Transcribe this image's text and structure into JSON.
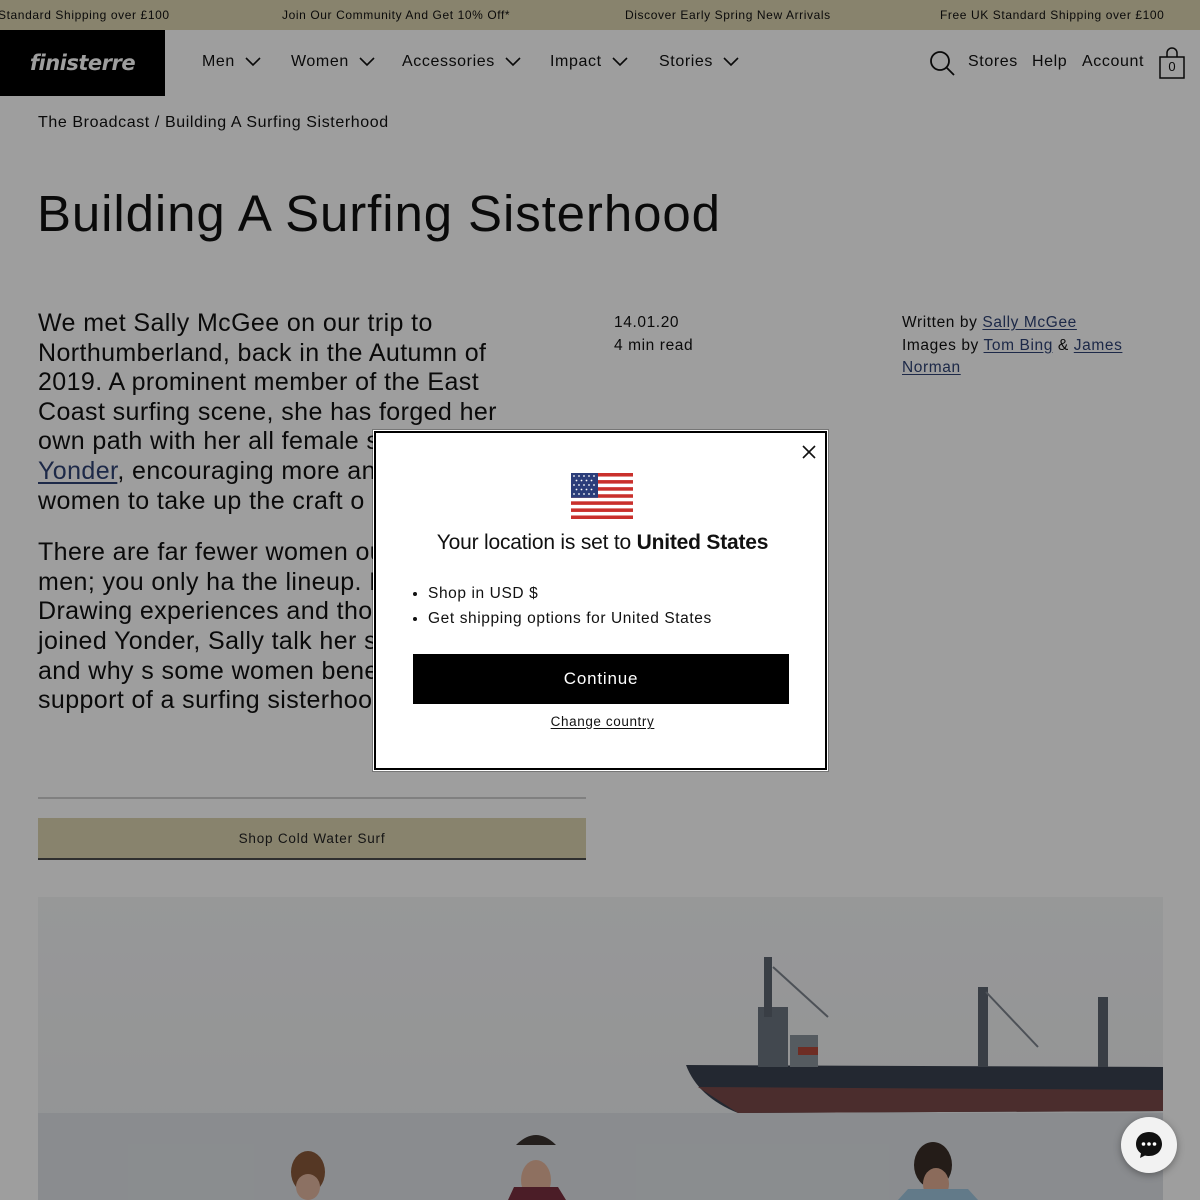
{
  "announcement": {
    "messages": [
      "Standard Shipping over £100",
      "Join Our Community And Get 10% Off*",
      "Discover Early Spring New Arrivals",
      "Free UK Standard Shipping over £100"
    ]
  },
  "header": {
    "logo": "finisterre",
    "nav": [
      "Men",
      "Women",
      "Accessories",
      "Impact",
      "Stories"
    ],
    "utility": {
      "stores": "Stores",
      "help": "Help",
      "account": "Account",
      "cart_count": "0"
    },
    "icons": [
      "search-icon",
      "bag-icon",
      "chevron-down-icon"
    ]
  },
  "breadcrumb": {
    "parent": "The Broadcast",
    "separator": "/",
    "current": "Building A Surfing Sisterhood"
  },
  "article": {
    "title": "Building A Surfing Sisterhood",
    "intro_p1_before": "We met Sally McGee on our trip to Northumberland, back in the Autumn of 2019. A prominent member of the East Coast surfing scene, she has forged her own path with her all female s",
    "intro_p1_link": "Yonder",
    "intro_p1_after": ", encouraging more an",
    "intro_p1_line7": "women to take up the craft o",
    "intro_p2": "There are far fewer women ou surfing than men; you only ha the lineup. But why? Drawing experiences and those of the have joined Yonder, Sally talk her surfing journey and why s some women benefit from ha support of a surfing sisterhoo",
    "date": "14.01.20",
    "read_time": "4 min read",
    "written_by_label": "Written by",
    "author": "Sally McGee",
    "images_by_label": "Images by",
    "photographer_1": "Tom Bing",
    "ampersand": "&",
    "photographer_2": "James Norman",
    "shop_button": "Shop Cold Water Surf"
  },
  "location_modal": {
    "heading_prefix": "Your location is set to",
    "country": "United States",
    "bullets": [
      "Shop in USD $",
      "Get shipping options for United States"
    ],
    "continue": "Continue",
    "change_country": "Change country",
    "flag_icon": "us-flag-icon",
    "close_icon": "close-icon"
  },
  "chat_widget": {
    "icon": "chat-bubble-icon"
  },
  "colors": {
    "announcement_bg": "#dcd3b0",
    "logo_bg": "#000000",
    "link": "#2f4374",
    "overlay": "rgba(0,0,0,0.38)",
    "button_black": "#000000"
  }
}
